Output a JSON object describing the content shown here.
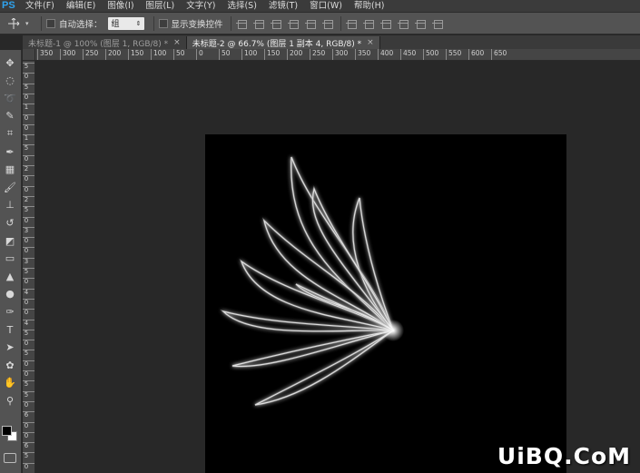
{
  "app": {
    "logo": "PS"
  },
  "menu": [
    {
      "name": "file",
      "label": "文件(F)"
    },
    {
      "name": "edit",
      "label": "编辑(E)"
    },
    {
      "name": "image",
      "label": "图像(I)"
    },
    {
      "name": "layer",
      "label": "图层(L)"
    },
    {
      "name": "type",
      "label": "文字(Y)"
    },
    {
      "name": "select",
      "label": "选择(S)"
    },
    {
      "name": "filter",
      "label": "滤镜(T)"
    },
    {
      "name": "window",
      "label": "窗口(W)"
    },
    {
      "name": "help",
      "label": "帮助(H)"
    }
  ],
  "options": {
    "auto_select_label": "自动选择：",
    "auto_select_value": "组",
    "show_transform_label": "显示变换控件"
  },
  "tabs": [
    {
      "label": "未标题-1 @ 100% (图层 1, RGB/8) *",
      "close": "×",
      "active": false
    },
    {
      "label": "未标题-2 @ 66.7% (图层 1 副本 4, RGB/8) *",
      "close": "×",
      "active": true
    }
  ],
  "ruler_h": [
    "350",
    "300",
    "250",
    "200",
    "150",
    "100",
    "50",
    "0",
    "50",
    "100",
    "150",
    "200",
    "250",
    "300",
    "350",
    "400",
    "450",
    "500",
    "550",
    "600",
    "650"
  ],
  "ruler_v": [
    "5",
    "0",
    "5",
    "0",
    "1",
    "0",
    "0",
    "1",
    "5",
    "0",
    "2",
    "0",
    "0",
    "2",
    "5",
    "0",
    "3",
    "0",
    "0",
    "3",
    "5",
    "0",
    "4",
    "0",
    "0",
    "4",
    "5",
    "0",
    "5",
    "0",
    "0",
    "5",
    "5",
    "0",
    "6",
    "0",
    "0",
    "6",
    "5",
    "0"
  ],
  "tools": [
    {
      "name": "move-tool-icon",
      "glyph": "✥"
    },
    {
      "name": "marquee-tool-icon",
      "glyph": "◌"
    },
    {
      "name": "lasso-tool-icon",
      "glyph": "➰"
    },
    {
      "name": "quick-select-tool-icon",
      "glyph": "✎"
    },
    {
      "name": "crop-tool-icon",
      "glyph": "⌗"
    },
    {
      "name": "eyedropper-tool-icon",
      "glyph": "✒"
    },
    {
      "name": "healing-brush-tool-icon",
      "glyph": "▦"
    },
    {
      "name": "brush-tool-icon",
      "glyph": "🖌"
    },
    {
      "name": "clone-stamp-tool-icon",
      "glyph": "⊥"
    },
    {
      "name": "history-brush-tool-icon",
      "glyph": "↺"
    },
    {
      "name": "eraser-tool-icon",
      "glyph": "◩"
    },
    {
      "name": "gradient-tool-icon",
      "glyph": "▭"
    },
    {
      "name": "blur-tool-icon",
      "glyph": "▲"
    },
    {
      "name": "dodge-tool-icon",
      "glyph": "●"
    },
    {
      "name": "pen-tool-icon",
      "glyph": "✑"
    },
    {
      "name": "type-tool-icon",
      "glyph": "T"
    },
    {
      "name": "path-select-tool-icon",
      "glyph": "➤"
    },
    {
      "name": "shape-tool-icon",
      "glyph": "✿"
    },
    {
      "name": "hand-tool-icon",
      "glyph": "✋"
    },
    {
      "name": "zoom-tool-icon",
      "glyph": "⚲"
    }
  ],
  "watermark": "UiBQ.CoM",
  "colors": {
    "accent": "#2fa3ee",
    "canvas": "#000000",
    "workspace": "#282828"
  }
}
